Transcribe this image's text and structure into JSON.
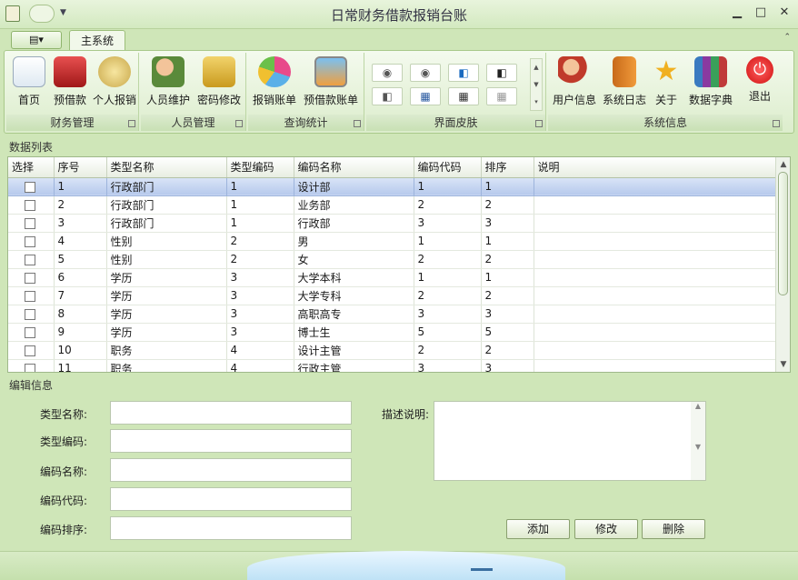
{
  "window": {
    "title": "日常财务借款报销台账"
  },
  "tabs": {
    "main": "主系统"
  },
  "ribbon": {
    "groups": [
      {
        "label": "财务管理",
        "buttons": [
          "首页",
          "预借款",
          "个人报销"
        ]
      },
      {
        "label": "人员管理",
        "buttons": [
          "人员维护",
          "密码修改"
        ]
      },
      {
        "label": "查询统计",
        "buttons": [
          "报销账单",
          "预借款账单"
        ]
      },
      {
        "label": "界面皮肤",
        "buttons": []
      },
      {
        "label": "系统信息",
        "buttons": [
          "用户信息",
          "系统日志",
          "关于",
          "数据字典",
          "退出"
        ]
      }
    ],
    "icons": {
      "首页": "document-icon",
      "预借款": "toolbox-icon",
      "个人报销": "coins-icon",
      "人员维护": "users-icon",
      "密码修改": "lock-icon",
      "报销账单": "pie-chart-icon",
      "预借款账单": "picture-icon",
      "用户信息": "user-add-icon",
      "系统日志": "notebook-icon",
      "关于": "star-icon",
      "数据字典": "books-icon",
      "退出": "power-icon"
    }
  },
  "grid": {
    "title": "数据列表",
    "columns": [
      "选择",
      "序号",
      "类型名称",
      "类型编码",
      "编码名称",
      "编码代码",
      "排序",
      "说明"
    ],
    "rows": [
      [
        "1",
        "行政部门",
        "1",
        "设计部",
        "1",
        "1",
        ""
      ],
      [
        "2",
        "行政部门",
        "1",
        "业务部",
        "2",
        "2",
        ""
      ],
      [
        "3",
        "行政部门",
        "1",
        "行政部",
        "3",
        "3",
        ""
      ],
      [
        "4",
        "性别",
        "2",
        "男",
        "1",
        "1",
        ""
      ],
      [
        "5",
        "性别",
        "2",
        "女",
        "2",
        "2",
        ""
      ],
      [
        "6",
        "学历",
        "3",
        "大学本科",
        "1",
        "1",
        ""
      ],
      [
        "7",
        "学历",
        "3",
        "大学专科",
        "2",
        "2",
        ""
      ],
      [
        "8",
        "学历",
        "3",
        "高职高专",
        "3",
        "3",
        ""
      ],
      [
        "9",
        "学历",
        "3",
        "博士生",
        "5",
        "5",
        ""
      ],
      [
        "10",
        "职务",
        "4",
        "设计主管",
        "2",
        "2",
        ""
      ],
      [
        "11",
        "职务",
        "4",
        "行政主管",
        "3",
        "3",
        ""
      ]
    ],
    "selected_row": 1
  },
  "form": {
    "title": "编辑信息",
    "fields": {
      "type_name": {
        "label": "类型名称:",
        "value": ""
      },
      "type_code": {
        "label": "类型编码:",
        "value": ""
      },
      "code_name": {
        "label": "编码名称:",
        "value": ""
      },
      "code_value": {
        "label": "编码代码:",
        "value": ""
      },
      "code_sort": {
        "label": "编码排序:",
        "value": ""
      },
      "description": {
        "label": "描述说明:",
        "value": ""
      }
    },
    "buttons": {
      "add": "添加",
      "edit": "修改",
      "delete": "删除"
    }
  },
  "colors": {
    "theme": "#cfe6b8",
    "selected_row": "#b6c9ec",
    "exit_icon": "#e02020"
  }
}
